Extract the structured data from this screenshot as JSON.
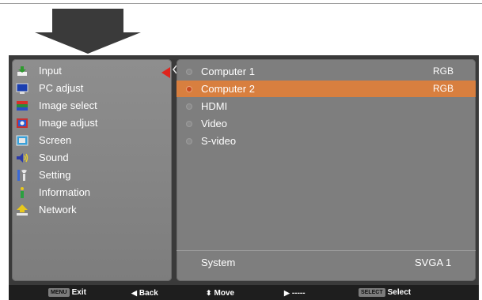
{
  "menu": {
    "items": [
      {
        "label": "Input",
        "icon": "input-icon"
      },
      {
        "label": "PC adjust",
        "icon": "monitor-icon"
      },
      {
        "label": "Image select",
        "icon": "image-select-icon"
      },
      {
        "label": "Image adjust",
        "icon": "image-adjust-icon"
      },
      {
        "label": "Screen",
        "icon": "screen-icon"
      },
      {
        "label": "Sound",
        "icon": "speaker-icon"
      },
      {
        "label": "Setting",
        "icon": "tools-icon"
      },
      {
        "label": "Information",
        "icon": "info-icon"
      },
      {
        "label": "Network",
        "icon": "network-icon"
      }
    ],
    "selected": "Input",
    "pointer_color": "#e0241c"
  },
  "sources": {
    "items": [
      {
        "name": "Computer 1",
        "format": "RGB"
      },
      {
        "name": "Computer 2",
        "format": "RGB"
      },
      {
        "name": "HDMI",
        "format": ""
      },
      {
        "name": "Video",
        "format": ""
      },
      {
        "name": "S-video",
        "format": ""
      }
    ],
    "active": "Computer 2",
    "highlight_color": "#d87f3f"
  },
  "system": {
    "label": "System",
    "value": "SVGA 1"
  },
  "hints": {
    "exit": {
      "key": "MENU",
      "label": "Exit"
    },
    "back": {
      "glyph": "◀",
      "label": "Back"
    },
    "move": {
      "glyph": "⬍",
      "label": "Move"
    },
    "next": {
      "glyph": "▶",
      "label": "-----"
    },
    "select": {
      "key": "SELECT",
      "label": "Select"
    }
  }
}
